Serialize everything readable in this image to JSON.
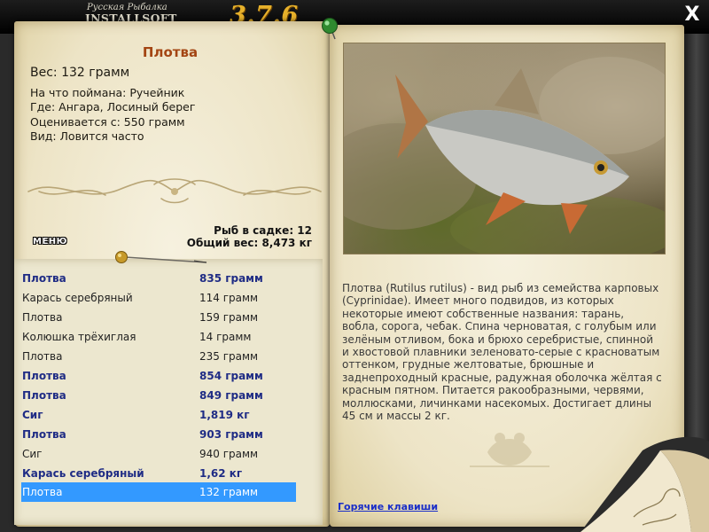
{
  "window": {
    "title_line1": "Русская Рыбалка",
    "title_line2": "INSTALLSOFT EDITION",
    "version": "3.7.6",
    "close_label": "X"
  },
  "catch": {
    "name": "Плотва",
    "weight_line": "Вес: 132 грамм",
    "details": [
      "На что поймана: Ручейник",
      "Где: Ангара, Лосиный берег",
      "Оценивается с: 550 грамм",
      "Вид: Ловится часто"
    ]
  },
  "stats": {
    "count_line": "Рыб в садке: 12",
    "total_line": "Общий вес: 8,473 кг"
  },
  "menu_label": "МЕНЮ",
  "fish_list": [
    {
      "name": "Плотва",
      "weight": "835 грамм",
      "bold": true
    },
    {
      "name": "Карась серебряный",
      "weight": "114 грамм",
      "bold": false
    },
    {
      "name": "Плотва",
      "weight": "159 грамм",
      "bold": false
    },
    {
      "name": "Колюшка трёхиглая",
      "weight": "14 грамм",
      "bold": false
    },
    {
      "name": "Плотва",
      "weight": "235 грамм",
      "bold": false
    },
    {
      "name": "Плотва",
      "weight": "854 грамм",
      "bold": true
    },
    {
      "name": "Плотва",
      "weight": "849 грамм",
      "bold": true
    },
    {
      "name": "Сиг",
      "weight": "1,819 кг",
      "bold": true
    },
    {
      "name": "Плотва",
      "weight": "903 грамм",
      "bold": true
    },
    {
      "name": "Сиг",
      "weight": "940 грамм",
      "bold": false
    },
    {
      "name": "Карась серебряный",
      "weight": "1,62 кг",
      "bold": true
    },
    {
      "name": "Плотва",
      "weight": "132 грамм",
      "bold": false,
      "selected": true
    }
  ],
  "description": "Плотва (Rutilus rutilus) - вид рыб из семейства карповых (Cyprinidae). Имеет много подвидов, из которых некоторые имеют собственные названия: тарань, вобла, сорога, чебак. Спина черноватая, с голубым или зелёным отливом, бока и брюхо серебристые, спинной и хвостовой плавники зеленовато-серые с красноватым оттенком, грудные желтоватые, брюшные и заднепроходный красные, радужная оболочка жёлтая с красным пятном. Питается ракообразными, червями, моллюсками, личинками насекомых. Достигает длины 45 см и массы 2 кг.",
  "hotkeys_label": "Горячие клавиши",
  "colors": {
    "fish_name": "#a34513",
    "bold_row": "#1f2c85",
    "selection": "#3399ff",
    "link": "#1a2ec8",
    "version": "#e6b02a"
  }
}
